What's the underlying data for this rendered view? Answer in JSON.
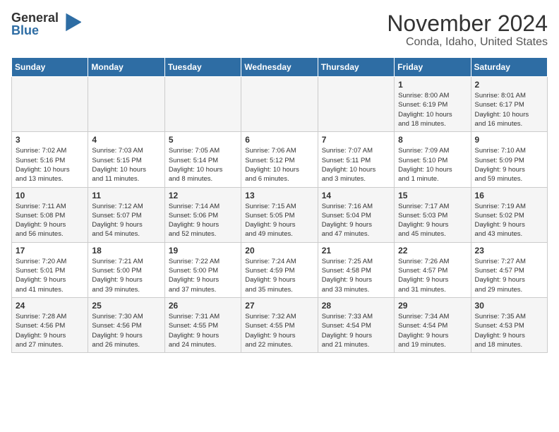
{
  "logo": {
    "general": "General",
    "blue": "Blue"
  },
  "title": "November 2024",
  "subtitle": "Conda, Idaho, United States",
  "days_of_week": [
    "Sunday",
    "Monday",
    "Tuesday",
    "Wednesday",
    "Thursday",
    "Friday",
    "Saturday"
  ],
  "weeks": [
    [
      {
        "day": "",
        "info": ""
      },
      {
        "day": "",
        "info": ""
      },
      {
        "day": "",
        "info": ""
      },
      {
        "day": "",
        "info": ""
      },
      {
        "day": "",
        "info": ""
      },
      {
        "day": "1",
        "info": "Sunrise: 8:00 AM\nSunset: 6:19 PM\nDaylight: 10 hours\nand 18 minutes."
      },
      {
        "day": "2",
        "info": "Sunrise: 8:01 AM\nSunset: 6:17 PM\nDaylight: 10 hours\nand 16 minutes."
      }
    ],
    [
      {
        "day": "3",
        "info": "Sunrise: 7:02 AM\nSunset: 5:16 PM\nDaylight: 10 hours\nand 13 minutes."
      },
      {
        "day": "4",
        "info": "Sunrise: 7:03 AM\nSunset: 5:15 PM\nDaylight: 10 hours\nand 11 minutes."
      },
      {
        "day": "5",
        "info": "Sunrise: 7:05 AM\nSunset: 5:14 PM\nDaylight: 10 hours\nand 8 minutes."
      },
      {
        "day": "6",
        "info": "Sunrise: 7:06 AM\nSunset: 5:12 PM\nDaylight: 10 hours\nand 6 minutes."
      },
      {
        "day": "7",
        "info": "Sunrise: 7:07 AM\nSunset: 5:11 PM\nDaylight: 10 hours\nand 3 minutes."
      },
      {
        "day": "8",
        "info": "Sunrise: 7:09 AM\nSunset: 5:10 PM\nDaylight: 10 hours\nand 1 minute."
      },
      {
        "day": "9",
        "info": "Sunrise: 7:10 AM\nSunset: 5:09 PM\nDaylight: 9 hours\nand 59 minutes."
      }
    ],
    [
      {
        "day": "10",
        "info": "Sunrise: 7:11 AM\nSunset: 5:08 PM\nDaylight: 9 hours\nand 56 minutes."
      },
      {
        "day": "11",
        "info": "Sunrise: 7:12 AM\nSunset: 5:07 PM\nDaylight: 9 hours\nand 54 minutes."
      },
      {
        "day": "12",
        "info": "Sunrise: 7:14 AM\nSunset: 5:06 PM\nDaylight: 9 hours\nand 52 minutes."
      },
      {
        "day": "13",
        "info": "Sunrise: 7:15 AM\nSunset: 5:05 PM\nDaylight: 9 hours\nand 49 minutes."
      },
      {
        "day": "14",
        "info": "Sunrise: 7:16 AM\nSunset: 5:04 PM\nDaylight: 9 hours\nand 47 minutes."
      },
      {
        "day": "15",
        "info": "Sunrise: 7:17 AM\nSunset: 5:03 PM\nDaylight: 9 hours\nand 45 minutes."
      },
      {
        "day": "16",
        "info": "Sunrise: 7:19 AM\nSunset: 5:02 PM\nDaylight: 9 hours\nand 43 minutes."
      }
    ],
    [
      {
        "day": "17",
        "info": "Sunrise: 7:20 AM\nSunset: 5:01 PM\nDaylight: 9 hours\nand 41 minutes."
      },
      {
        "day": "18",
        "info": "Sunrise: 7:21 AM\nSunset: 5:00 PM\nDaylight: 9 hours\nand 39 minutes."
      },
      {
        "day": "19",
        "info": "Sunrise: 7:22 AM\nSunset: 5:00 PM\nDaylight: 9 hours\nand 37 minutes."
      },
      {
        "day": "20",
        "info": "Sunrise: 7:24 AM\nSunset: 4:59 PM\nDaylight: 9 hours\nand 35 minutes."
      },
      {
        "day": "21",
        "info": "Sunrise: 7:25 AM\nSunset: 4:58 PM\nDaylight: 9 hours\nand 33 minutes."
      },
      {
        "day": "22",
        "info": "Sunrise: 7:26 AM\nSunset: 4:57 PM\nDaylight: 9 hours\nand 31 minutes."
      },
      {
        "day": "23",
        "info": "Sunrise: 7:27 AM\nSunset: 4:57 PM\nDaylight: 9 hours\nand 29 minutes."
      }
    ],
    [
      {
        "day": "24",
        "info": "Sunrise: 7:28 AM\nSunset: 4:56 PM\nDaylight: 9 hours\nand 27 minutes."
      },
      {
        "day": "25",
        "info": "Sunrise: 7:30 AM\nSunset: 4:56 PM\nDaylight: 9 hours\nand 26 minutes."
      },
      {
        "day": "26",
        "info": "Sunrise: 7:31 AM\nSunset: 4:55 PM\nDaylight: 9 hours\nand 24 minutes."
      },
      {
        "day": "27",
        "info": "Sunrise: 7:32 AM\nSunset: 4:55 PM\nDaylight: 9 hours\nand 22 minutes."
      },
      {
        "day": "28",
        "info": "Sunrise: 7:33 AM\nSunset: 4:54 PM\nDaylight: 9 hours\nand 21 minutes."
      },
      {
        "day": "29",
        "info": "Sunrise: 7:34 AM\nSunset: 4:54 PM\nDaylight: 9 hours\nand 19 minutes."
      },
      {
        "day": "30",
        "info": "Sunrise: 7:35 AM\nSunset: 4:53 PM\nDaylight: 9 hours\nand 18 minutes."
      }
    ]
  ]
}
